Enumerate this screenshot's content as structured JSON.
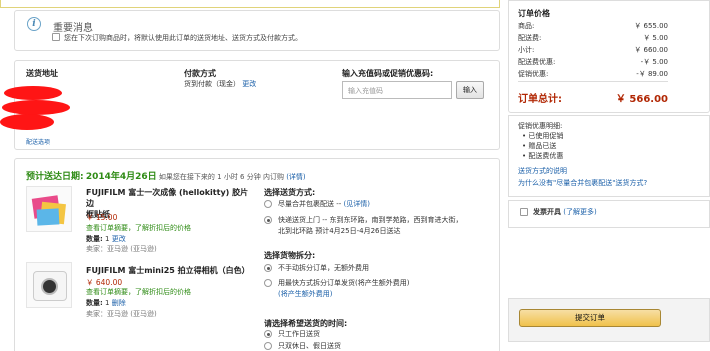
{
  "notice": {
    "title": "重要消息",
    "text": "您在下次订购商品时，将默认使用此订单的送货地址、送货方式及付款方式。"
  },
  "address": {
    "heading": "送货地址",
    "change_link": "配送选项",
    "redacted_color": "#ff1515"
  },
  "payment": {
    "heading": "付款方式",
    "method": "货到付款（现金）",
    "change_link": "更改"
  },
  "coupon": {
    "heading": "输入充值码或促销优惠码:",
    "placeholder": "输入充值码",
    "button": "输入"
  },
  "shipping": {
    "eta_label": "预计送达日期:",
    "eta_date": "2014年4月26日",
    "eta_note": "如果您在接下来的 1 小时 6 分钟 内订购",
    "details_link": "(详情)",
    "items": [
      {
        "title_line1": "FUJIFILM 富士一次成像 (hellokitty) 胶片边",
        "title_line2": "框贴纸",
        "price": "￥ 15.00",
        "summary_link": "查看订单摘要，了解折扣后的价格",
        "qty_label": "数量:",
        "qty": "1",
        "qty_link": "更改",
        "seller": "卖家：亚马逊 (亚马逊)"
      },
      {
        "title_line1": "FUJIFILM 富士mini25 拍立得相机（白色）",
        "price": "￥ 640.00",
        "summary_link": "查看订单摘要，了解折扣后的价格",
        "qty_label": "数量:",
        "qty": "1",
        "qty_link": "删除",
        "seller": "卖家：亚马逊 (亚马逊)"
      }
    ],
    "method": {
      "heading": "选择送货方式:",
      "option1": "尽量合并包裹配送 --",
      "option1_link": "(见详情)",
      "option2_line1": "快递送货上门 -- 东到东环路，南到学苑路，西到育进大街，",
      "option2_line2": "北到北环路 预计4月25日-4月26日送达"
    },
    "split": {
      "heading": "选择货物拆分:",
      "option1": "不手动拆分订单，无额外费用",
      "option2_line1": "用最快方式拆分订单发货(将产生额外费用)",
      "option2_line2": "(将产生额外费用)"
    },
    "time": {
      "heading": "请选择希望送货的时间:",
      "option1": "只工作日送货",
      "option2": "只双休日、假日送货"
    }
  },
  "summary": {
    "heading": "订单价格",
    "rows": [
      {
        "label": "商品:",
        "value": "￥ 655.00"
      },
      {
        "label": "配送费:",
        "value": "￥ 5.00"
      },
      {
        "label": "小计:",
        "value": "￥ 660.00"
      },
      {
        "label": "配送费优惠:",
        "value": "-￥ 5.00"
      },
      {
        "label": "促销优惠:",
        "value": "-￥ 89.00"
      }
    ],
    "total_label": "订单总计:",
    "total_value": "￥ 566.00"
  },
  "promo": {
    "heading": "促销优惠明细:",
    "items": [
      "已使用促销",
      "赠品已送",
      "配送费优惠"
    ],
    "link1": "送货方式的说明",
    "link2": "为什么没有\"尽量合并包裹配送\"送货方式?"
  },
  "invoice": {
    "label": "发票开具",
    "link": "(了解更多)"
  },
  "submit": {
    "label": "提交订单"
  },
  "colors": {
    "accent_red": "#b12704",
    "link_blue": "#1a5fa8",
    "green": "#2e8b14",
    "button_yellow": "#f0c14b"
  }
}
